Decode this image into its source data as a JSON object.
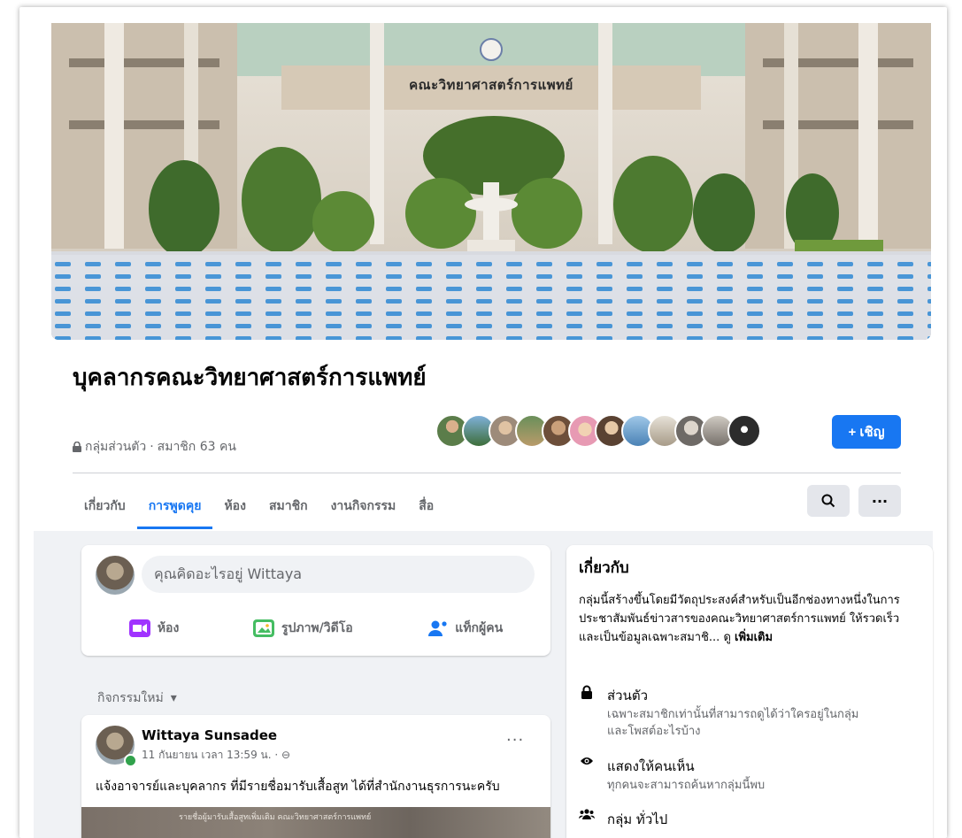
{
  "cover": {
    "sign_text": "คณะวิทยาศาสตร์การแพทย์"
  },
  "group": {
    "title": "บุคลากรคณะวิทยาศาสตร์การแพทย์",
    "privacy": "กลุ่มส่วนตัว",
    "separator": " · ",
    "member_count": "สมาชิก 63 คน"
  },
  "invite_button": "+ เชิญ",
  "tabs": [
    {
      "label": "เกี่ยวกับ",
      "active": false
    },
    {
      "label": "การพูดคุย",
      "active": true
    },
    {
      "label": "ห้อง",
      "active": false
    },
    {
      "label": "สมาชิก",
      "active": false
    },
    {
      "label": "งานกิจกรรม",
      "active": false
    },
    {
      "label": "สื่อ",
      "active": false
    }
  ],
  "toolbar": {
    "search_icon": "search-icon",
    "more_icon": "more-icon",
    "more_label": "···"
  },
  "composer": {
    "placeholder": "คุณคิดอะไรอยู่ Wittaya",
    "actions": [
      {
        "label": "ห้อง",
        "icon": "video-room-icon",
        "color": "#a033ff"
      },
      {
        "label": "รูปภาพ/วิดีโอ",
        "icon": "photo-video-icon",
        "color": "#45bd62"
      },
      {
        "label": "แท็กผู้คน",
        "icon": "tag-people-icon",
        "color": "#1877f2"
      }
    ]
  },
  "activity": {
    "label": "กิจกรรมใหม่",
    "caret": "▾"
  },
  "post": {
    "author": "Wittaya Sunsadee",
    "time": "11 กันยายน เวลา 13:59 น. · ⊖",
    "more": "···",
    "text": "แจ้งอาจารย์และบุคลากร ที่มีรายชื่อมารับเสื้อสูท ได้ที่สำนักงานธุรการนะครับ",
    "image_caption": "รายชื่อผู้มารับเสื้อสูทเพิ่มเติม คณะวิทยาศาสตร์การแพทย์"
  },
  "about": {
    "title": "เกี่ยวกับ",
    "description": "กลุ่มนี้สร้างขึ้นโดยมีวัตถุประสงค์สำหรับเป็นอีกช่องทางหนึ่งในการประชาสัมพันธ์ข่าวสารของคณะวิทยาศาสตร์การแพทย์ ให้รวดเร็ว และเป็นข้อมูลเฉพาะสมาชิ... ดู",
    "more": "เพิ่มเติม",
    "items": [
      {
        "icon": "lock-icon",
        "glyph": "🔒",
        "title": "ส่วนตัว",
        "sub": "เฉพาะสมาชิกเท่านั้นที่สามารถดูได้ว่าใครอยู่ในกลุ่มและโพสต์อะไรบ้าง"
      },
      {
        "icon": "eye-icon",
        "glyph": "👁",
        "title": "แสดงให้คนเห็น",
        "sub": "ทุกคนจะสามารถค้นหากลุ่มนี้พบ"
      },
      {
        "icon": "group-icon",
        "glyph": "👥",
        "title": "กลุ่ม ทั่วไป",
        "sub": ""
      }
    ]
  },
  "colors": {
    "accent": "#1877f2",
    "background": "#f0f2f5",
    "muted_text": "#65676b"
  }
}
